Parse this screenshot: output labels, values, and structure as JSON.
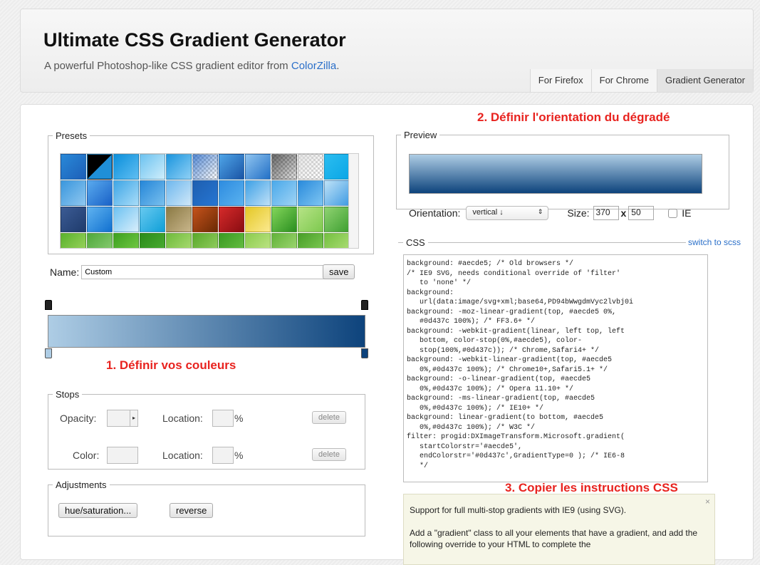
{
  "header": {
    "title": "Ultimate CSS Gradient Generator",
    "subtitle_prefix": "A powerful Photoshop-like CSS gradient editor from ",
    "subtitle_link": "ColorZilla",
    "subtitle_suffix": ".",
    "tabs": [
      {
        "label": "For Firefox",
        "active": false
      },
      {
        "label": "For Chrome",
        "active": false
      },
      {
        "label": "Gradient Generator",
        "active": true
      }
    ]
  },
  "presets": {
    "legend": "Presets",
    "swatches": [
      [
        "#1d5fb8",
        "#2989d8"
      ],
      [
        "#000000",
        "#1f8fd8",
        "diag"
      ],
      [
        "#5fbef2",
        "#0b8fdb"
      ],
      [
        "#cfeefb",
        "#6cc2f0"
      ],
      [
        "#8fd0f5",
        "#1b95de"
      ],
      [
        "#2d6ec9",
        "#ffffff",
        "check"
      ],
      [
        "#1a54a5",
        "#4fa5e8"
      ],
      [
        "#2370c6",
        "#8fc4f0"
      ],
      [
        "#444444",
        "#999999",
        "check"
      ],
      [
        "#dddddd",
        "#ffffff",
        "check"
      ],
      [
        "#0aa6e6",
        "#2bbdf0"
      ],
      [
        "#8fc7ef",
        "#3a97de"
      ],
      [
        "#1961c7",
        "#59aaee"
      ],
      [
        "#a8dcf8",
        "#3fa6e6"
      ],
      [
        "#79c0ee",
        "#2586d8"
      ],
      [
        "#cfe7f8",
        "#6fb8ee"
      ],
      [
        "#2675d2",
        "#1e5fb0"
      ],
      [
        "#5ab2ef",
        "#2e8ce0"
      ],
      [
        "#bfe0f7",
        "#3ea1e6"
      ],
      [
        "#9fd3f5",
        "#4aa9ea"
      ],
      [
        "#7ec5f2",
        "#2a8bdc"
      ],
      [
        "#3f9be3",
        "#bfe2f7"
      ],
      [
        "#1f3b6c",
        "#3b5b94"
      ],
      [
        "#1170d0",
        "#5fb3f0"
      ],
      [
        "#d8eefb",
        "#6ec2f2"
      ],
      [
        "#0f9fd8",
        "#67c9f0"
      ],
      [
        "#c8b58a",
        "#8b7a45"
      ],
      [
        "#6b2a05",
        "#c5521b"
      ],
      [
        "#8a0d12",
        "#d52a2a"
      ],
      [
        "#fbe98f",
        "#e4c826"
      ],
      [
        "#2a8f20",
        "#83d55a"
      ],
      [
        "#7ec94f",
        "#b6e386"
      ],
      [
        "#3e9f31",
        "#8fd371"
      ],
      [
        "#a4d864",
        "#5ab22d"
      ],
      [
        "#91d17a",
        "#4fa83b"
      ],
      [
        "#7bd04a",
        "#3ca020"
      ],
      [
        "#4fb236",
        "#2b8b1a"
      ],
      [
        "#b3e07a",
        "#6fbb3c"
      ],
      [
        "#9bd367",
        "#5aa92b"
      ],
      [
        "#6cc447",
        "#3b9a23"
      ],
      [
        "#c6e88e",
        "#8ccc4e"
      ],
      [
        "#a8dc7a",
        "#62b33a"
      ],
      [
        "#86cf5a",
        "#489f28"
      ],
      [
        "#b6e27f",
        "#74c040"
      ]
    ]
  },
  "name_row": {
    "label": "Name:",
    "value": "Custom",
    "save_label": "save"
  },
  "gradient": {
    "start": "#aecde5",
    "end": "#0d437c"
  },
  "annotations": {
    "step1": "1. Définir vos couleurs",
    "step2": "2. Définir l'orientation du dégradé",
    "step3": "3. Copier les instructions CSS"
  },
  "stops": {
    "legend": "Stops",
    "opacity_label": "Opacity:",
    "color_label": "Color:",
    "location_label": "Location:",
    "percent": "%",
    "delete_label": "delete",
    "arrow": "▸"
  },
  "adjustments": {
    "legend": "Adjustments",
    "hue_label": "hue/saturation...",
    "reverse_label": "reverse"
  },
  "preview": {
    "legend": "Preview",
    "orientation_label": "Orientation:",
    "orientation_value": "vertical ↓",
    "select_arrow": "⇕",
    "size_label": "Size:",
    "size_w": "370",
    "size_x": "x",
    "size_h": "50",
    "ie_label": "IE"
  },
  "css": {
    "legend": "CSS",
    "switch_label": "switch to scss",
    "code": "background: #aecde5; /* Old browsers */\n/* IE9 SVG, needs conditional override of 'filter'\n   to 'none' */\nbackground:\n   url(data:image/svg+xml;base64,PD94bWwgdmVyc2lvbj0i\nbackground: -moz-linear-gradient(top, #aecde5 0%,\n   #0d437c 100%); /* FF3.6+ */\nbackground: -webkit-gradient(linear, left top, left\n   bottom, color-stop(0%,#aecde5), color-\n   stop(100%,#0d437c)); /* Chrome,Safari4+ */\nbackground: -webkit-linear-gradient(top, #aecde5\n   0%,#0d437c 100%); /* Chrome10+,Safari5.1+ */\nbackground: -o-linear-gradient(top, #aecde5\n   0%,#0d437c 100%); /* Opera 11.10+ */\nbackground: -ms-linear-gradient(top, #aecde5\n   0%,#0d437c 100%); /* IE10+ */\nbackground: linear-gradient(to bottom, #aecde5\n   0%,#0d437c 100%); /* W3C */\nfilter: progid:DXImageTransform.Microsoft.gradient(\n   startColorstr='#aecde5',\n   endColorstr='#0d437c',GradientType=0 ); /* IE6-8\n   */"
  },
  "support": {
    "close_icon": "×",
    "p1": "Support for full multi-stop gradients with IE9 (using SVG).",
    "p2": "Add a \"gradient\" class to all your elements that have a gradient, and add the following override to your HTML to complete the"
  }
}
